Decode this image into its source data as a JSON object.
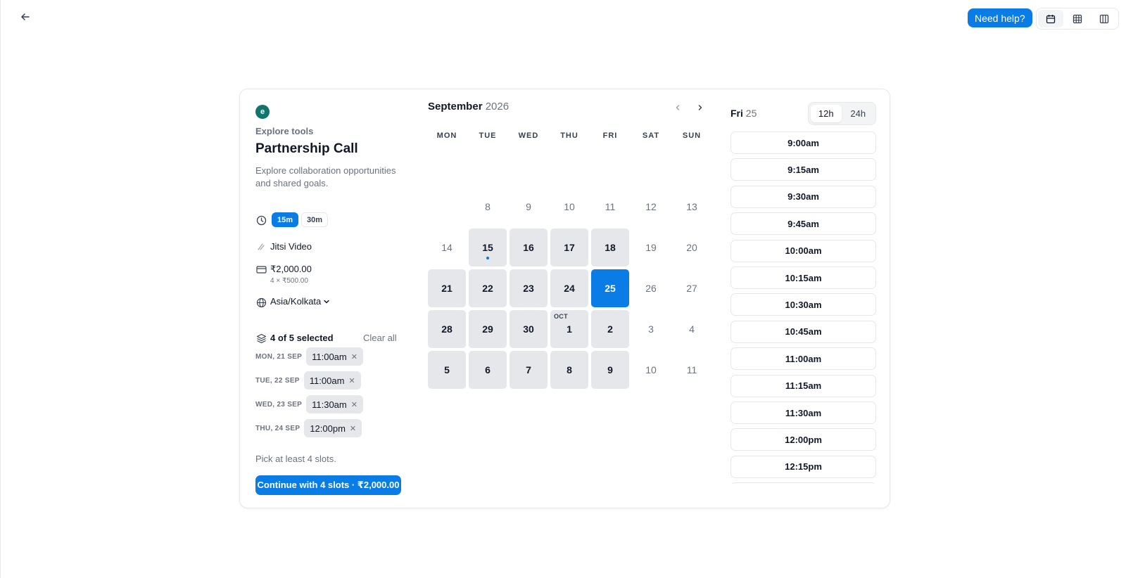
{
  "topbar": {
    "back_icon": "arrow-left-icon",
    "help_label": "Need help?",
    "views": [
      "calendar-icon",
      "grid-icon",
      "columns-icon"
    ]
  },
  "event": {
    "avatar_letter": "e",
    "avatar_color": "#0f766e",
    "org_name": "Explore tools",
    "title": "Partnership Call",
    "description": "Explore collaboration opportunities and shared goals.",
    "durations": [
      "15m",
      "30m"
    ],
    "selected_duration": "15m",
    "location": "Jitsi Video",
    "price": "₹2,000.00",
    "price_breakdown": "4 × ₹500.00",
    "timezone": "Asia/Kolkata"
  },
  "selection": {
    "count_label": "4 of 5 selected",
    "clear_label": "Clear all",
    "slots": [
      {
        "date": "MON, 21 SEP",
        "time": "11:00am"
      },
      {
        "date": "TUE, 22 SEP",
        "time": "11:00am"
      },
      {
        "date": "WED, 23 SEP",
        "time": "11:30am"
      },
      {
        "date": "THU, 24 SEP",
        "time": "12:00pm"
      }
    ],
    "hint": "Pick at least 4 slots.",
    "continue_label": "Continue with 4 slots · ₹2,000.00"
  },
  "calendar": {
    "month": "September",
    "year": "2026",
    "weekdays": [
      "MON",
      "TUE",
      "WED",
      "THU",
      "FRI",
      "SAT",
      "SUN"
    ],
    "weeks": [
      [
        "",
        "8",
        "9",
        "10",
        "11",
        "12",
        "13"
      ],
      [
        "14",
        "15",
        "16",
        "17",
        "18",
        "19",
        "20"
      ],
      [
        "21",
        "22",
        "23",
        "24",
        "25",
        "26",
        "27"
      ],
      [
        "28",
        "29",
        "30",
        "1",
        "2",
        "3",
        "4"
      ],
      [
        "5",
        "6",
        "7",
        "8",
        "9",
        "10",
        "11"
      ]
    ],
    "available": [
      [
        1,
        1
      ],
      [
        1,
        2
      ],
      [
        1,
        3
      ],
      [
        1,
        4
      ],
      [
        2,
        0
      ],
      [
        2,
        1
      ],
      [
        2,
        2
      ],
      [
        2,
        3
      ],
      [
        3,
        0
      ],
      [
        3,
        1
      ],
      [
        3,
        2
      ],
      [
        3,
        3
      ],
      [
        3,
        4
      ],
      [
        4,
        0
      ],
      [
        4,
        1
      ],
      [
        4,
        2
      ],
      [
        4,
        3
      ],
      [
        4,
        4
      ]
    ],
    "selected": [
      2,
      4
    ],
    "today_marker": [
      1,
      1
    ],
    "month_tag": {
      "cell": [
        3,
        3
      ],
      "label": "OCT"
    }
  },
  "times": {
    "day_name": "Fri",
    "day_num": "25",
    "formats": [
      "12h",
      "24h"
    ],
    "active_format": "12h",
    "slots": [
      "9:00am",
      "9:15am",
      "9:30am",
      "9:45am",
      "10:00am",
      "10:15am",
      "10:30am",
      "10:45am",
      "11:00am",
      "11:15am",
      "11:30am",
      "12:00pm",
      "12:15pm"
    ]
  },
  "colors": {
    "accent": "#0a7ce6",
    "available_bg": "#e5e7eb"
  }
}
